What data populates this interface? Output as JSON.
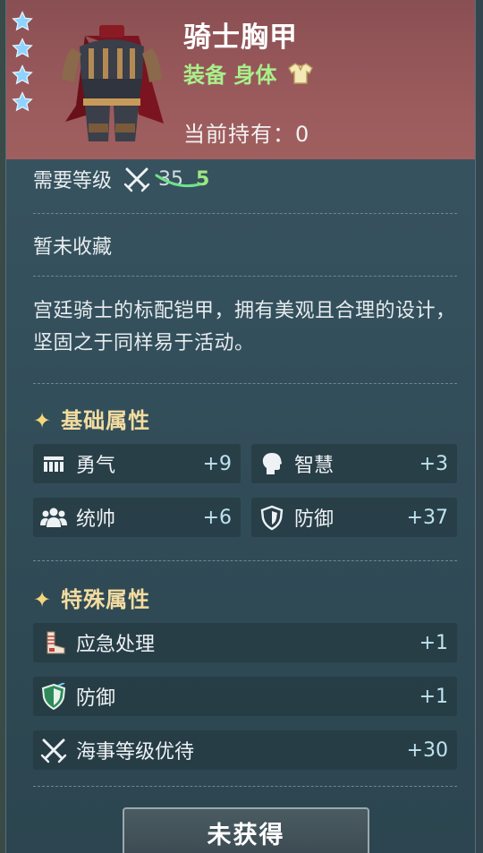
{
  "item": {
    "name": "骑士胸甲",
    "equip_category": "装备 身体",
    "owned_text": "当前持有：0",
    "stars": 4
  },
  "requirement": {
    "label": "需要等级",
    "old_level": "35",
    "new_level": "5"
  },
  "collection_status": "暂未收藏",
  "description": "宫廷骑士的标配铠甲，拥有美观且合理的设计，坚固之于同样易于活动。",
  "base_attributes": {
    "title": "基础属性",
    "items": [
      {
        "name": "勇气",
        "value": "+9",
        "icon": "courage-icon"
      },
      {
        "name": "智慧",
        "value": "+3",
        "icon": "wisdom-head-icon"
      },
      {
        "name": "统帅",
        "value": "+6",
        "icon": "command-group-icon"
      },
      {
        "name": "防御",
        "value": "+37",
        "icon": "shield-icon"
      }
    ]
  },
  "special_attributes": {
    "title": "特殊属性",
    "items": [
      {
        "name": "应急处理",
        "value": "+1",
        "icon": "bandage-icon"
      },
      {
        "name": "防御",
        "value": "+1",
        "icon": "green-shield-icon"
      },
      {
        "name": "海事等级优待",
        "value": "+30",
        "icon": "crossed-swords-icon"
      }
    ]
  },
  "action_button": "未获得",
  "colors": {
    "header": "#9a5a5c",
    "equip_green": "#a9f08a",
    "new_level_green": "#9be882",
    "section_gold": "#f3dca0",
    "value_blue": "#bfe3ef"
  }
}
